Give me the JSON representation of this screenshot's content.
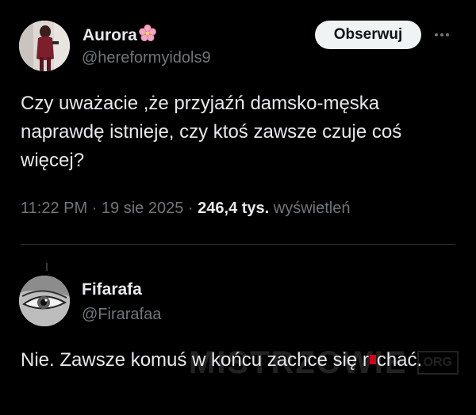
{
  "post": {
    "author": {
      "name": "Aurora",
      "handle": "@hereformyidols9",
      "name_emoji": "cherry-blossom-icon"
    },
    "follow_label": "Obserwuj",
    "more_icon": "more-horizontal-icon",
    "text": "Czy  uważacie ,że przyjaźń damsko-męska naprawdę istnieje, czy ktoś zawsze czuje coś więcej?",
    "time": "11:22 PM",
    "separator": "·",
    "date": "19 sie 2025",
    "views_count": "246,4 tys.",
    "views_label": "wyświetleń"
  },
  "reply": {
    "author": {
      "name": "Fifarafa",
      "handle": "@Firarafaa"
    },
    "text_before": "Nie. Zawsze komuś w końcu zachce się r",
    "text_after": "chać."
  },
  "watermark": {
    "text": "MISTRZOWIE",
    "badge": "ORG"
  },
  "colors": {
    "background": "#000000",
    "primary_text": "#e7e9ea",
    "secondary_text": "#71767b",
    "divider": "#2f3336",
    "button_bg": "#eff3f4",
    "redaction": "#d0021b"
  }
}
